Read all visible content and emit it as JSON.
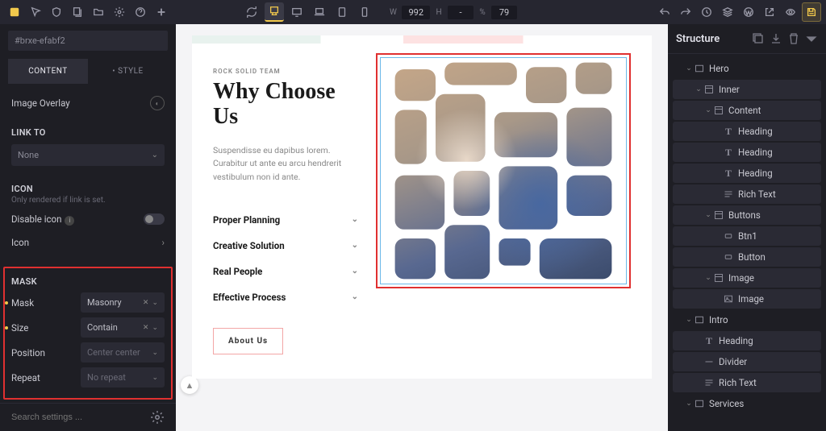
{
  "topbar": {
    "width_label": "W",
    "width_val": "992",
    "height_label": "H",
    "height_val": "-",
    "pct_label": "%",
    "pct_val": "79"
  },
  "left": {
    "css_id": "#brxe-efabf2",
    "tab_content": "CONTENT",
    "tab_style": "• STYLE",
    "image_overlay": "Image Overlay",
    "link_to": "LINK TO",
    "link_to_val": "None",
    "icon_head": "ICON",
    "icon_sub": "Only rendered if link is set.",
    "disable_icon": "Disable icon",
    "icon_label": "Icon",
    "mask_head": "MASK",
    "mask_lbl": "Mask",
    "mask_val": "Masonry",
    "size_lbl": "Size",
    "size_val": "Contain",
    "pos_lbl": "Position",
    "pos_val": "Center center",
    "rep_lbl": "Repeat",
    "rep_val": "No repeat",
    "search_ph": "Search settings ..."
  },
  "page": {
    "kicker": "ROCK SOLID TEAM",
    "heading_a": "Why Choose",
    "heading_b": "Us",
    "para": "Suspendisse eu dapibus lorem. Curabitur ut ante eu arcu hendrerit vestibulum non id ante.",
    "acc": [
      "Proper Planning",
      "Creative Solution",
      "Real People",
      "Effective Process"
    ],
    "about": "About Us"
  },
  "right": {
    "title": "Structure",
    "tree": [
      {
        "d": 0,
        "t": "top",
        "icon": "sect",
        "label": "Hero",
        "open": true
      },
      {
        "d": 1,
        "t": "row",
        "icon": "cont",
        "label": "Inner",
        "open": true
      },
      {
        "d": 2,
        "t": "row",
        "icon": "cont",
        "label": "Content",
        "open": true
      },
      {
        "d": 3,
        "t": "leaf",
        "icon": "T",
        "label": "Heading"
      },
      {
        "d": 3,
        "t": "leaf",
        "icon": "T",
        "label": "Heading"
      },
      {
        "d": 3,
        "t": "leaf",
        "icon": "T",
        "label": "Heading"
      },
      {
        "d": 3,
        "t": "leaf",
        "icon": "lines",
        "label": "Rich Text"
      },
      {
        "d": 2,
        "t": "row",
        "icon": "cont",
        "label": "Buttons",
        "open": true
      },
      {
        "d": 3,
        "t": "leaf",
        "icon": "box",
        "label": "Btn1"
      },
      {
        "d": 3,
        "t": "leaf",
        "icon": "box",
        "label": "Button"
      },
      {
        "d": 2,
        "t": "row",
        "icon": "cont",
        "label": "Image",
        "open": true
      },
      {
        "d": 3,
        "t": "leaf",
        "icon": "img",
        "label": "Image"
      },
      {
        "d": 0,
        "t": "top",
        "icon": "sect",
        "label": "Intro",
        "open": true
      },
      {
        "d": 1,
        "t": "leaf",
        "icon": "T",
        "label": "Heading"
      },
      {
        "d": 1,
        "t": "leaf",
        "icon": "div",
        "label": "Divider"
      },
      {
        "d": 1,
        "t": "leaf",
        "icon": "lines",
        "label": "Rich Text"
      },
      {
        "d": 0,
        "t": "top",
        "icon": "sect",
        "label": "Services",
        "open": true
      }
    ]
  }
}
